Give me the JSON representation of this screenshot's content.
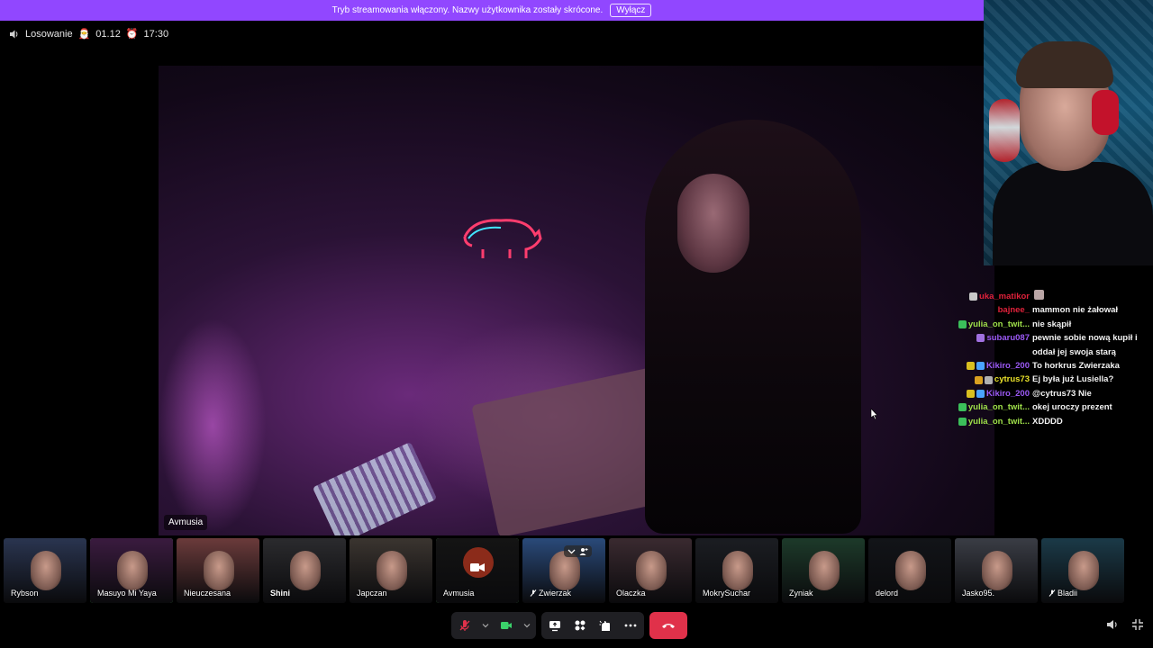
{
  "banner": {
    "text": "Tryb streamowania włączony. Nazwy użytkownika zostały skrócone.",
    "button_label": "Wyłącz",
    "color": "#9147ff"
  },
  "call_info": {
    "title": "Losowanie",
    "date": "01.12",
    "time": "17:30",
    "icons": [
      "speaker-icon",
      "calendar-santa-icon",
      "alarm-clock-icon"
    ]
  },
  "main_video": {
    "participant": "Avmusia"
  },
  "chat": [
    {
      "user": "uka_matikor",
      "color": "#e0213a",
      "badges": [
        "#c9c9c9"
      ],
      "text": "",
      "has_emote": true
    },
    {
      "user": "bajnee_",
      "color": "#e0213a",
      "badges": [],
      "text": "mammon nie żałował"
    },
    {
      "user": "yulia_on_twit...",
      "color": "#9fe04a",
      "badges": [
        "#3bbf5a"
      ],
      "text": "nie skąpił"
    },
    {
      "user": "subaru087",
      "color": "#9b59f5",
      "badges": [
        "#a070e0"
      ],
      "text": "pewnie sobie nową kupił i oddał jej swoja starą"
    },
    {
      "user": "Kikiro_200",
      "color": "#9b59f5",
      "badges": [
        "#d9c020",
        "#4aa3ff"
      ],
      "text": "To horkrus Zwierzaka"
    },
    {
      "user": "cytrus73",
      "color": "#e8e02a",
      "badges": [
        "#d9a020",
        "#b0b0b0"
      ],
      "text": "Ej była już Lusiella?"
    },
    {
      "user": "Kikiro_200",
      "color": "#9b59f5",
      "badges": [
        "#d9c020",
        "#4aa3ff"
      ],
      "text": "@cytrus73 Nie"
    },
    {
      "user": "yulia_on_twit...",
      "color": "#9fe04a",
      "badges": [
        "#3bbf5a"
      ],
      "text": "okej uroczy prezent"
    },
    {
      "user": "yulia_on_twit...",
      "color": "#9fe04a",
      "badges": [
        "#3bbf5a"
      ],
      "text": "XDDDD"
    }
  ],
  "participants": [
    {
      "name": "Rybson",
      "muted": false,
      "bg": "#2a3550",
      "active": false
    },
    {
      "name": "Masuyo Mi Yaya",
      "muted": false,
      "bg": "#3a1b3f",
      "active": true
    },
    {
      "name": "Nieuczesana",
      "muted": false,
      "bg": "#6b3b3b",
      "active": false
    },
    {
      "name": "Shini",
      "muted": false,
      "bg": "#2b2b2e",
      "active": false,
      "bold": true
    },
    {
      "name": "Japczan",
      "muted": false,
      "bg": "#3b3530",
      "active": false
    },
    {
      "name": "Avmusia",
      "muted": false,
      "bg": "#141414",
      "active": true,
      "avatar": true
    },
    {
      "name": "Zwierzak",
      "muted": true,
      "bg": "#2a4a7a",
      "active": false,
      "overlay": true
    },
    {
      "name": "Olaczka",
      "muted": false,
      "bg": "#3a2a30",
      "active": false
    },
    {
      "name": "MokrySuchar",
      "muted": false,
      "bg": "#1b1d22",
      "active": false
    },
    {
      "name": "Zyniak",
      "muted": false,
      "bg": "#1d3a2a",
      "active": false
    },
    {
      "name": "delord",
      "muted": false,
      "bg": "#121418",
      "active": false
    },
    {
      "name": "Jasko95.",
      "muted": false,
      "bg": "#3a3d45",
      "active": false
    },
    {
      "name": "Bladii",
      "muted": true,
      "bg": "#1b3a48",
      "active": false
    }
  ],
  "toolbar": {
    "buttons": [
      "mic-muted-icon",
      "camera-icon",
      "screen-share-icon",
      "activities-icon",
      "effects-icon",
      "more-icon",
      "hang-up-icon"
    ],
    "hangup_color": "#e0314a",
    "camera_color": "#3bd16a",
    "mic_color": "#e0314a"
  }
}
